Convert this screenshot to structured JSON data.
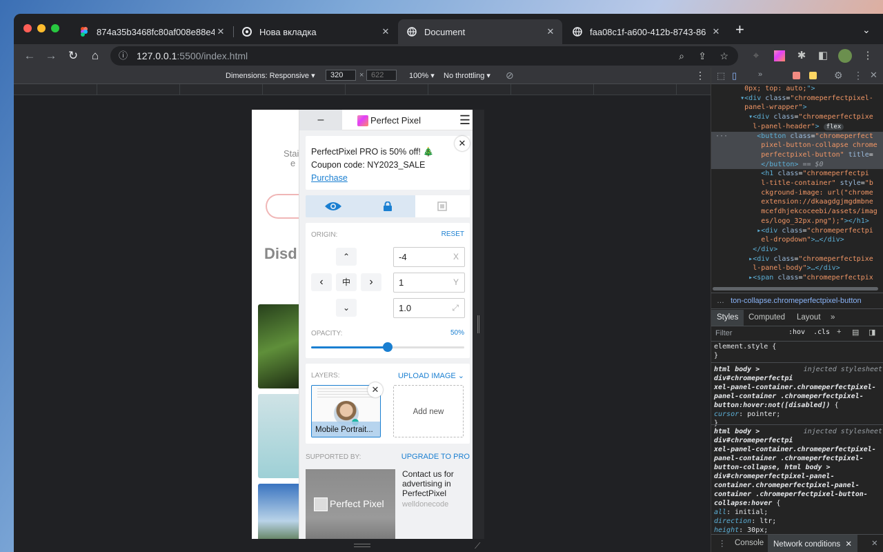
{
  "browser": {
    "tabs": [
      {
        "title": "874a35b3468fc80af008e88e4",
        "icon": "figma-icon"
      },
      {
        "title": "Нова вкладка",
        "icon": "chrome-icon"
      },
      {
        "title": "Document",
        "icon": "globe-icon",
        "active": true
      },
      {
        "title": "faa08c1f-a600-412b-8743-86",
        "icon": "globe-icon"
      }
    ],
    "new_tab": "+",
    "tab_close": "✕",
    "url_host": "127.0.0.1",
    "url_path": ":5500/index.html"
  },
  "device_toolbar": {
    "dimensions_label": "Dimensions: Responsive ▾",
    "width": "320",
    "height": "622",
    "times": "×",
    "zoom": "100% ▾",
    "throttling": "No throttling ▾"
  },
  "page": {
    "text_line1": "Stai",
    "text_line2": "e",
    "heading": "Disd"
  },
  "perfect_pixel": {
    "collapse": "–",
    "title": "Perfect Pixel",
    "menu": "☰",
    "promo": {
      "line1": "PerfectPixel PRO is 50% off! 🎄",
      "line2": "Coupon code: NY2023_SALE",
      "link": "Purchase",
      "close": "✕"
    },
    "origin": {
      "label": "ORIGIN:",
      "reset": "RESET",
      "x_value": "-4",
      "x_unit": "X",
      "y_value": "1",
      "y_unit": "Y",
      "scale_value": "1.0",
      "scale_unit": "⤢",
      "up": "⌃",
      "down": "⌄",
      "left": "‹",
      "right": "›",
      "center": "中"
    },
    "opacity": {
      "label": "OPACITY:",
      "value": "50%",
      "level": 0.5
    },
    "layers": {
      "label": "LAYERS:",
      "upload": "UPLOAD IMAGE ⌄",
      "items": [
        {
          "name": "Mobile Portrait..."
        }
      ],
      "add_new": "Add new",
      "remove": "✕"
    },
    "supported": {
      "label": "SUPPORTED BY:",
      "upgrade": "UPGRADE TO PRO",
      "ad_brand": "Perfect Pixel",
      "contact": "Contact us for advertising in PerfectPixel",
      "sponsor": "welldonecode"
    }
  },
  "devtools": {
    "styles_tabs": [
      "Styles",
      "Computed",
      "Layout",
      "»"
    ],
    "filter_placeholder": "Filter",
    "hov": ":hov",
    "cls": ".cls",
    "breadcrumb": "ton-collapse.chromeperfectpixel-button",
    "drawer_tabs": [
      "Console",
      "Network conditions"
    ],
    "flex_badge": "flex",
    "eq": "== $0",
    "injected": "injected stylesheet"
  },
  "colors": {
    "accent": "#1a7fd1",
    "panel_bg": "#f0f1f3",
    "devtools_bg": "#242424"
  }
}
